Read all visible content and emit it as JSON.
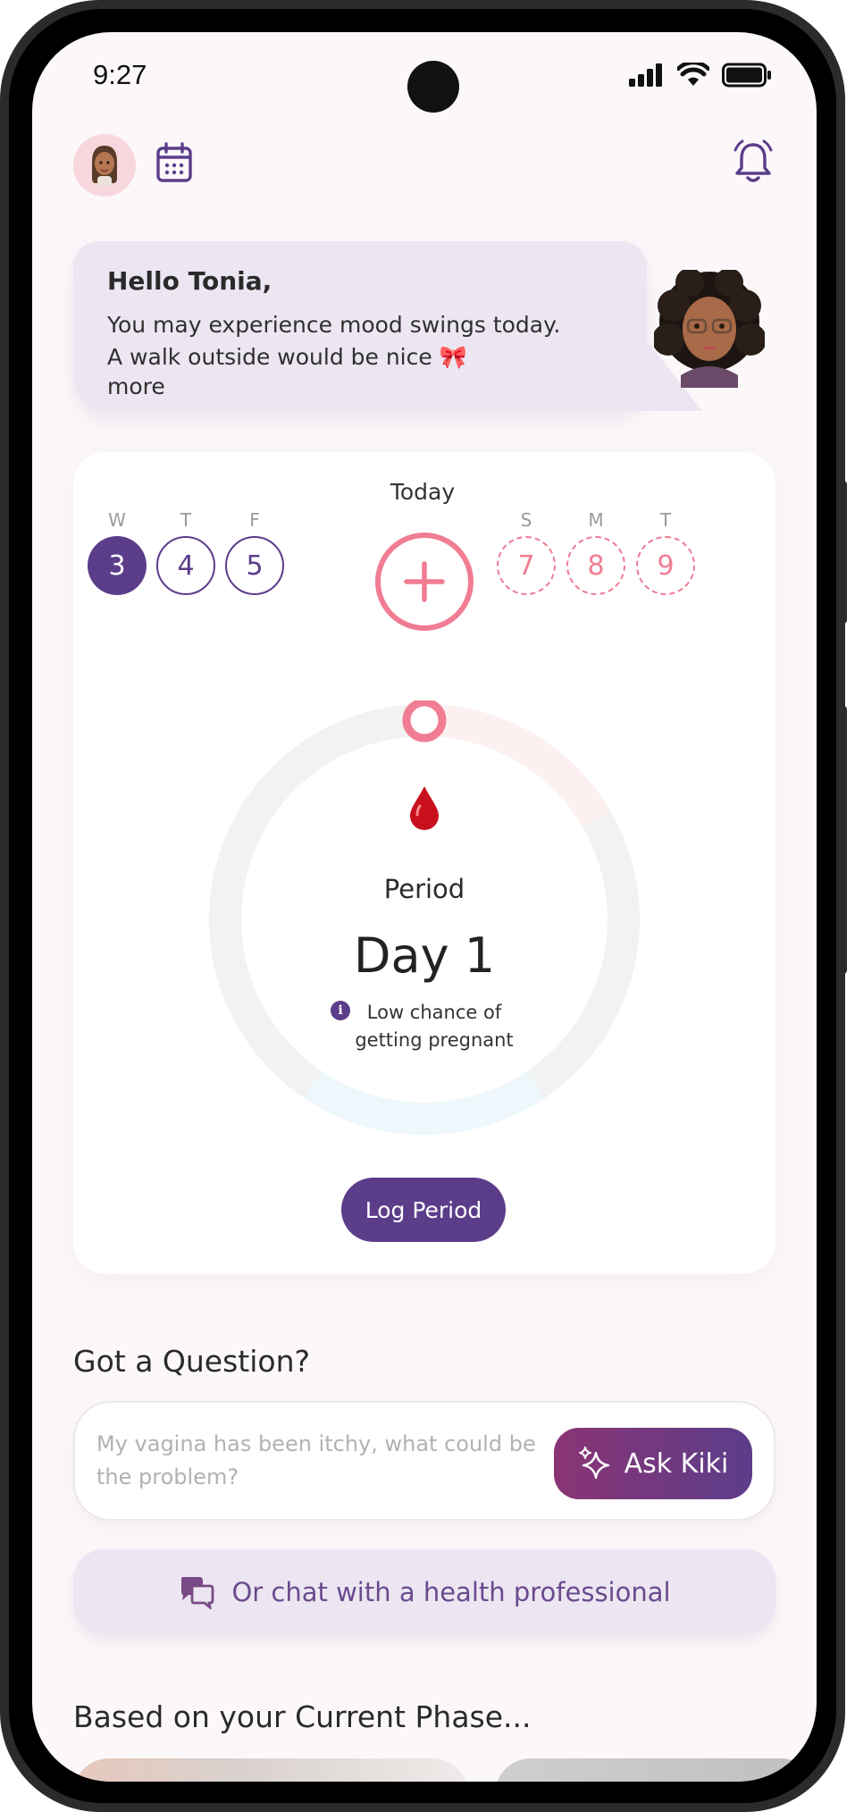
{
  "status_bar": {
    "time": "9:27"
  },
  "greeting": {
    "title": "Hello Tonia,",
    "message": "You may experience mood swings today. A walk outside would be nice 🎀",
    "more": "more"
  },
  "week_strip": {
    "today_label": "Today",
    "days": [
      {
        "letter": "W",
        "number": "3",
        "state": "selected"
      },
      {
        "letter": "T",
        "number": "4",
        "state": "past"
      },
      {
        "letter": "F",
        "number": "5",
        "state": "past"
      },
      {
        "letter": "",
        "number": "",
        "state": "today-add"
      },
      {
        "letter": "S",
        "number": "7",
        "state": "predicted"
      },
      {
        "letter": "M",
        "number": "8",
        "state": "predicted"
      },
      {
        "letter": "T",
        "number": "9",
        "state": "predicted"
      }
    ]
  },
  "cycle": {
    "phase": "Period",
    "day": "Day 1",
    "fertility_note": "Low chance of getting pregnant",
    "log_button": "Log Period"
  },
  "question": {
    "title": "Got a Question?",
    "placeholder": "My vagina has been itchy, what could be the problem?",
    "ask_button": "Ask Kiki",
    "chat_button": "Or chat with a health professional"
  },
  "phase_section": {
    "title": "Based on your Current Phase..."
  },
  "colors": {
    "primary": "#5c3d8a",
    "period_pink": "#f07d92",
    "greeting_bg": "#ebe6f1",
    "ask_gradient_start": "#8a3474"
  },
  "icons": [
    "avatar-memoji",
    "calendar-icon",
    "bell-icon",
    "blood-drop-icon",
    "info-icon",
    "sparkles-icon",
    "chat-bubbles-icon",
    "plus-icon"
  ]
}
